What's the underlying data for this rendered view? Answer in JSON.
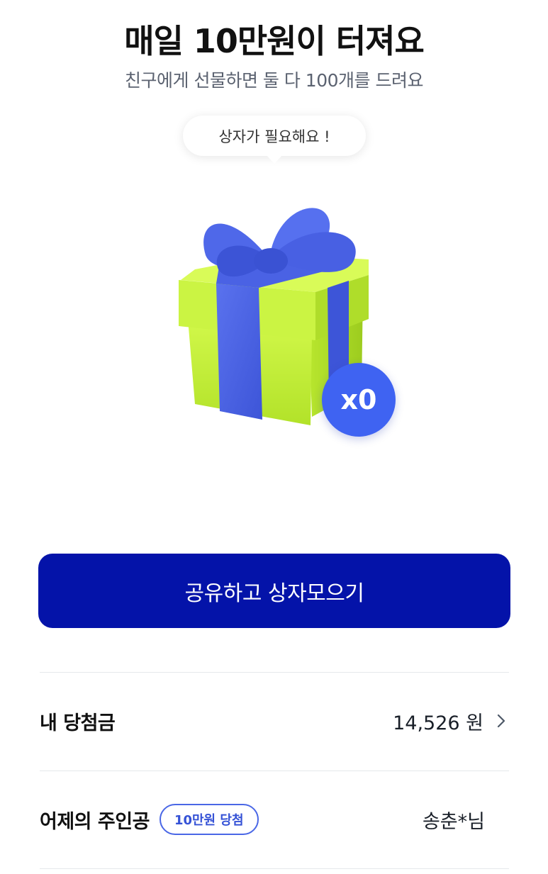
{
  "header": {
    "title": "매일 10만원이 터져요",
    "subtitle": "친구에게 선물하면 둘 다 100개를 드려요"
  },
  "tooltip": {
    "text": "상자가 필요해요 !"
  },
  "gift": {
    "icon": "gift-box-icon",
    "count_label": "x0",
    "colors": {
      "box": "#c8f23c",
      "ribbon": "#4b63e6",
      "badge": "#3f63f2"
    }
  },
  "share_button": {
    "label": "공유하고 상자모으기",
    "color": "#0413a9"
  },
  "winnings": {
    "label": "내 당첨금",
    "amount": "14,526 원"
  },
  "yesterday": {
    "label": "어제의 주인공",
    "badge": "10만원 당첨",
    "winner": "송춘*님"
  }
}
